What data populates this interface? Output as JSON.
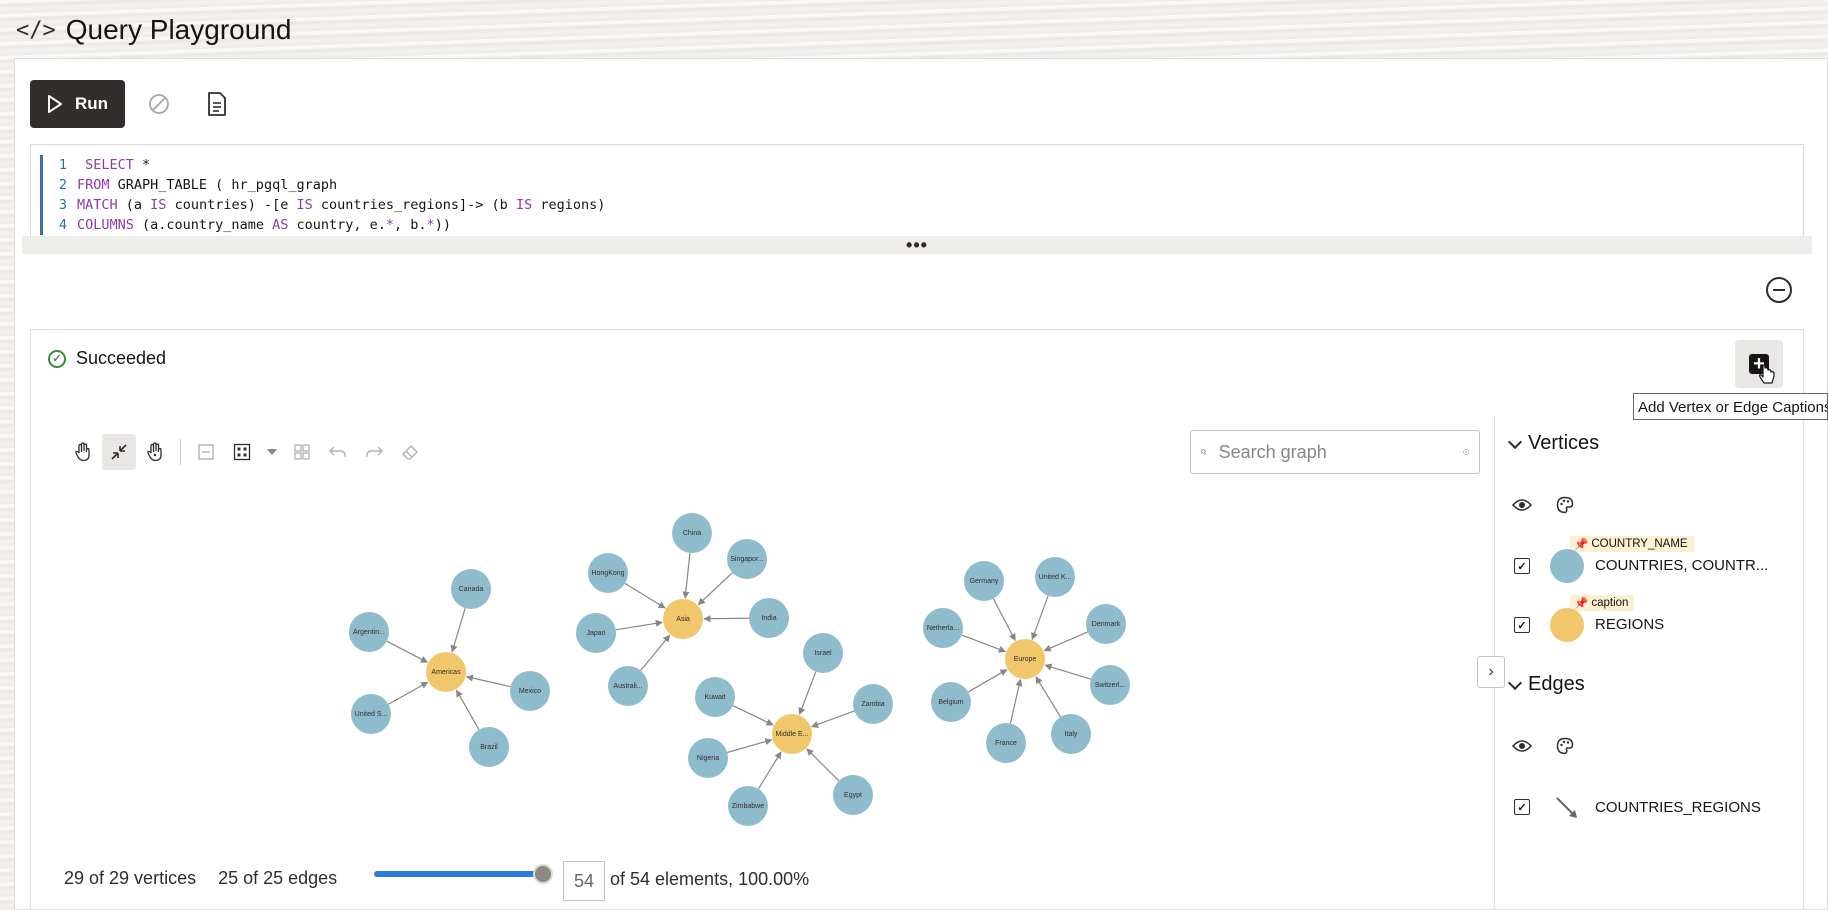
{
  "page": {
    "title": "Query Playground",
    "title_icon": "code-icon"
  },
  "toolbar": {
    "run_label": "Run"
  },
  "editor": {
    "lines": [
      {
        "num": "1",
        "parts": [
          {
            "t": " SELECT ",
            "k": 1
          },
          {
            "t": "*",
            "k": 0
          }
        ]
      },
      {
        "num": "2",
        "parts": [
          {
            "t": "FROM ",
            "k": 1
          },
          {
            "t": "GRAPH_TABLE ( hr_pgql_graph",
            "k": 0
          }
        ]
      },
      {
        "num": "3",
        "parts": [
          {
            "t": "MATCH ",
            "k": 1
          },
          {
            "t": "(a ",
            "k": 0
          },
          {
            "t": "IS",
            "k": 1
          },
          {
            "t": " countries) -[e ",
            "k": 0
          },
          {
            "t": "IS",
            "k": 1
          },
          {
            "t": " countries_regions]-> (b ",
            "k": 0
          },
          {
            "t": "IS",
            "k": 1
          },
          {
            "t": " regions)",
            "k": 0
          }
        ]
      },
      {
        "num": "4",
        "parts": [
          {
            "t": "COLUMNS ",
            "k": 1
          },
          {
            "t": "(a.country_name ",
            "k": 0
          },
          {
            "t": "AS",
            "k": 1
          },
          {
            "t": " country, e.",
            "k": 0
          },
          {
            "t": "*",
            "k": 1
          },
          {
            "t": ", b.",
            "k": 0
          },
          {
            "t": "*",
            "k": 1
          },
          {
            "t": "))",
            "k": 0
          }
        ]
      }
    ],
    "divider_label": "•••"
  },
  "result": {
    "status": "Succeeded",
    "tooltip": "Add Vertex or Edge Captions"
  },
  "graph_toolbar": {
    "buttons": [
      "hand-icon",
      "fit-to-screen-icon",
      "select-hand-icon",
      "collapse-icon",
      "group-icon",
      "layout-icon",
      "undo-icon",
      "redo-icon",
      "eraser-icon"
    ]
  },
  "search": {
    "placeholder": "Search graph"
  },
  "graph": {
    "colors": {
      "country": "#8fbccd",
      "region": "#f0c76b",
      "edge": "#8a8683"
    },
    "region_labels": [
      "Americas",
      "Asia",
      "Middle E...",
      "Europe"
    ],
    "country_labels": [
      "Canada",
      "Argentin...",
      "Mexico",
      "United S...",
      "Brazil",
      "China",
      "HongKong",
      "Singapor...",
      "Japan",
      "India",
      "Australi...",
      "Israel",
      "Kuwait",
      "Zambia",
      "Nigeria",
      "Zimbabwe",
      "Egypt",
      "Germany",
      "United K...",
      "Netherla...",
      "Denmark",
      "Belgium",
      "Switzerl...",
      "France",
      "Italy"
    ]
  },
  "side_panel": {
    "vertices_title": "Vertices",
    "edges_title": "Edges",
    "vertices": [
      {
        "badge": "COUNTRY_NAME",
        "label": "COUNTRIES, COUNTR...",
        "color": "#8fbccd"
      },
      {
        "badge": "caption",
        "label": "REGIONS",
        "color": "#f0c76b"
      }
    ],
    "edges": [
      {
        "label": "COUNTRIES_REGIONS"
      }
    ]
  },
  "stats": {
    "vertices": "29 of 29 vertices",
    "edges": "25 of 25 edges",
    "count": "54",
    "elements": "of 54 elements, 100.00%",
    "slider_fraction": 1.0
  }
}
